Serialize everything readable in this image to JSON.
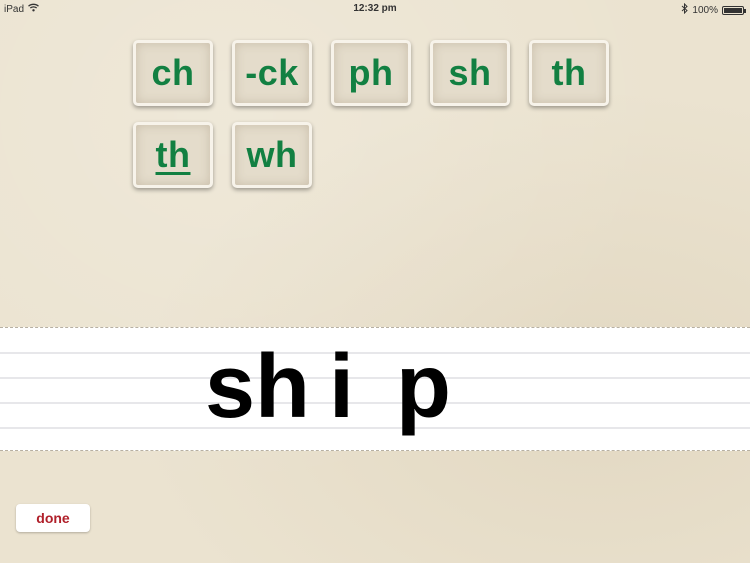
{
  "status_bar": {
    "device": "iPad",
    "time": "12:32 pm",
    "battery": "100%",
    "icons": [
      "wifi-icon",
      "bluetooth-icon",
      "battery-icon"
    ]
  },
  "tiles": [
    {
      "label": "ch",
      "underlined": false
    },
    {
      "label": "-ck",
      "underlined": false
    },
    {
      "label": "ph",
      "underlined": false
    },
    {
      "label": "sh",
      "underlined": false
    },
    {
      "label": "th",
      "underlined": false
    },
    {
      "label": "th",
      "underlined": true
    },
    {
      "label": "wh",
      "underlined": false
    }
  ],
  "word": {
    "parts": [
      "sh",
      "i",
      "p"
    ]
  },
  "done_label": "done",
  "colors": {
    "tile_text": "#128042",
    "done_text": "#b0202a",
    "word_text": "#000000"
  }
}
